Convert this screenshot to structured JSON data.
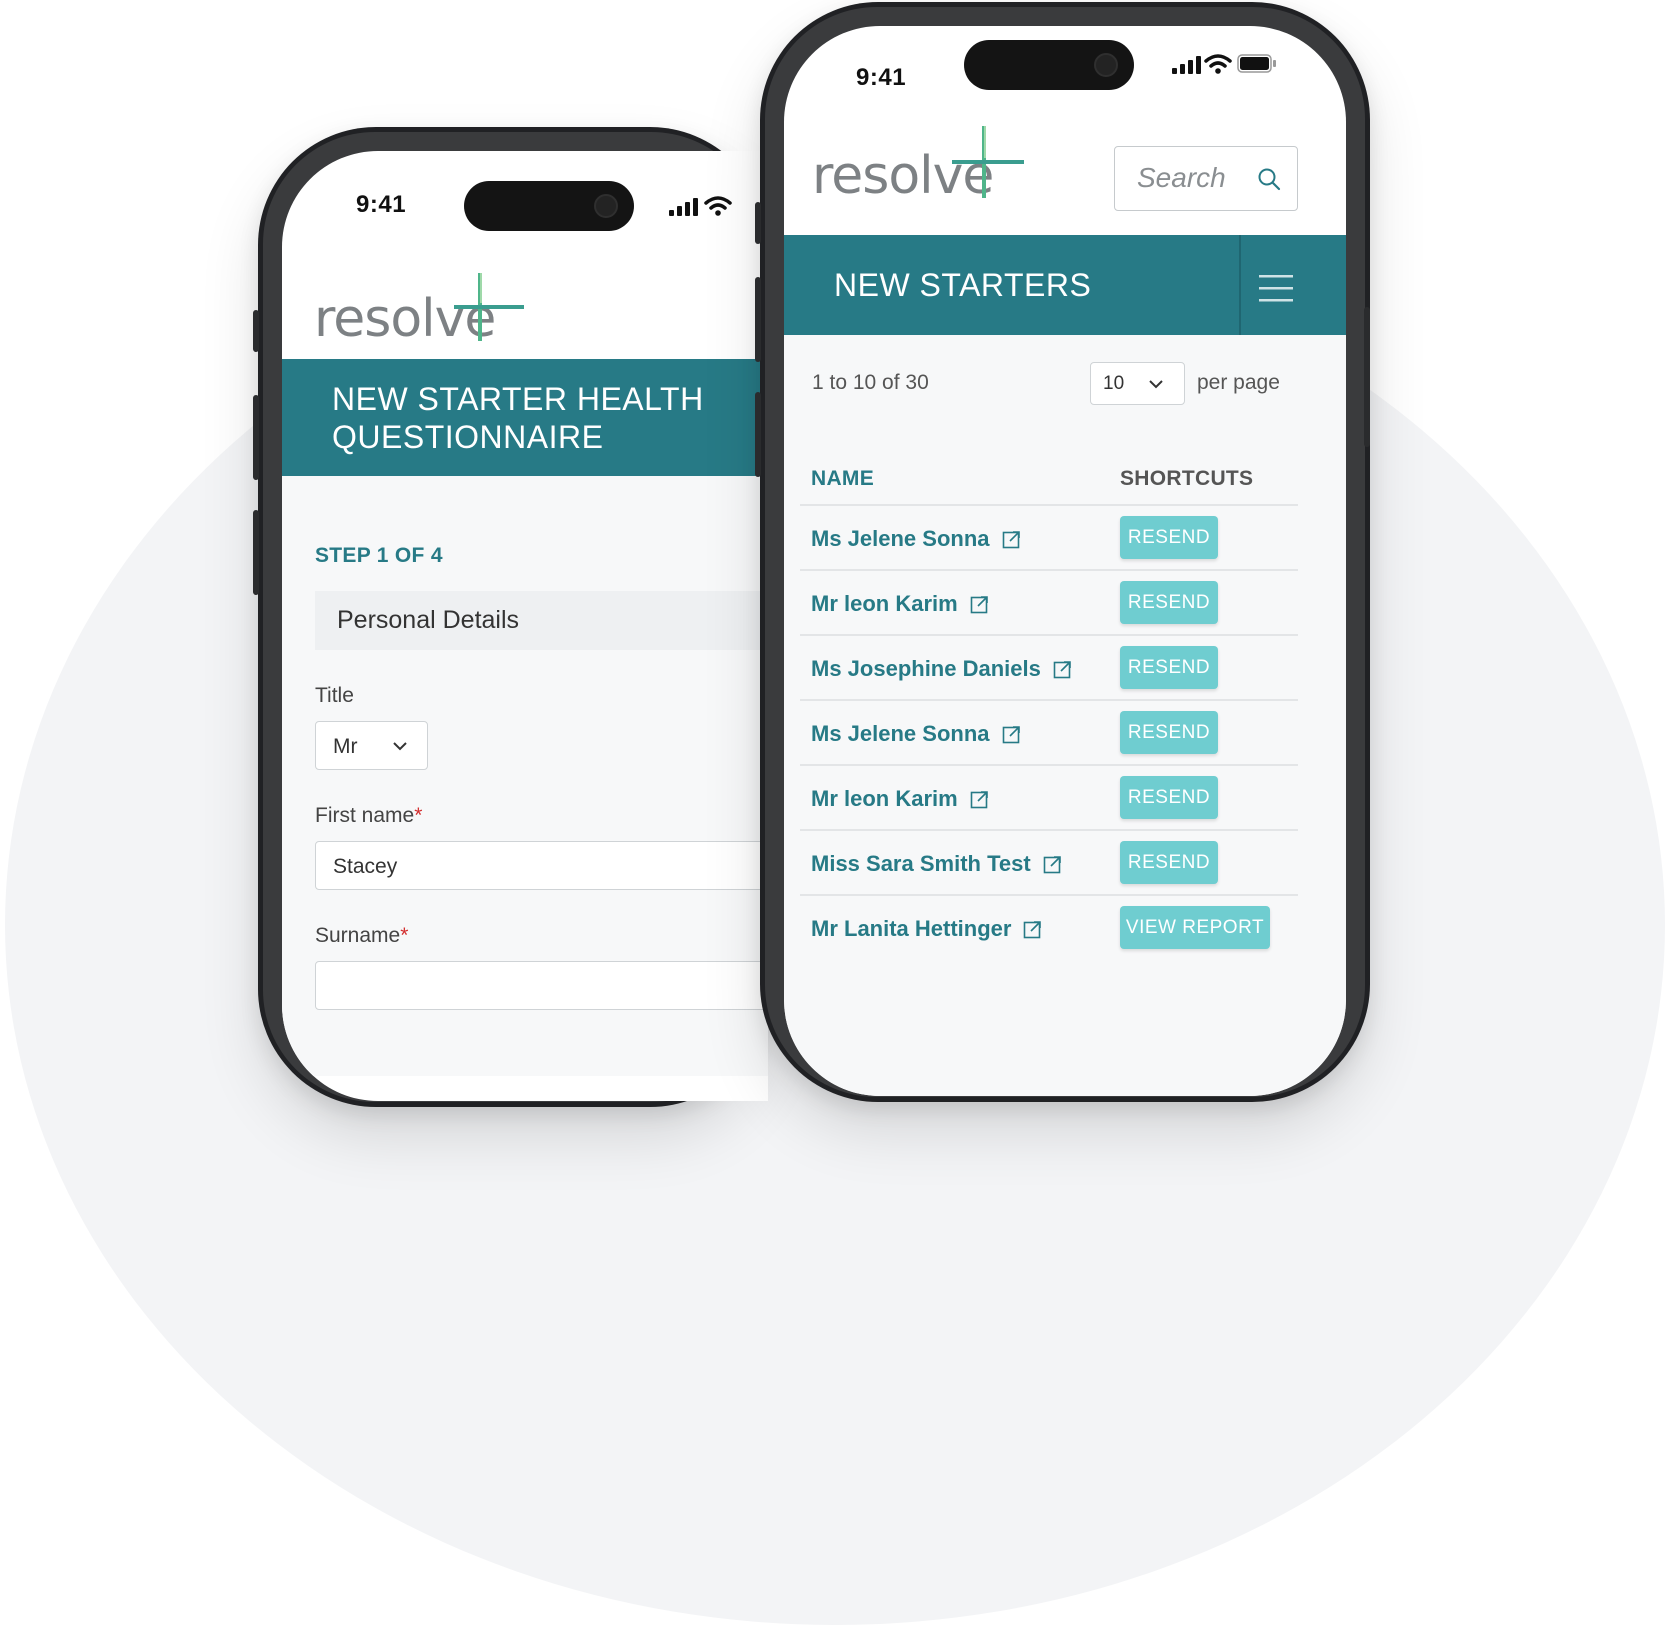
{
  "colors": {
    "brand_teal": "#277a86",
    "button_teal": "#6fcdd0",
    "required_red": "#d32f2f",
    "logo_gray": "#7d8184",
    "logo_green": "#4fb58a"
  },
  "icons": [
    "signal-icon",
    "wifi-icon",
    "battery-icon",
    "search-icon",
    "menu-icon",
    "chevron-down-icon",
    "external-link-icon",
    "logo-cross-icon"
  ],
  "questionnaire_phone": {
    "status_time": "9:41",
    "logo_text": "resolve",
    "banner_title_line1": "NEW STARTER HEALTH",
    "banner_title_line2": "QUESTIONNAIRE",
    "step_label": "STEP 1 OF 4",
    "section_title": "Personal Details",
    "title_label": "Title",
    "title_value": "Mr",
    "first_name_label": "First name",
    "first_name_value": "Stacey",
    "surname_label": "Surname",
    "required_mark": "*"
  },
  "starters_phone": {
    "status_time": "9:41",
    "logo_text": "resolve",
    "search_placeholder": "Search",
    "banner_title": "NEW STARTERS",
    "range_text": "1 to 10 of 30",
    "per_page_value": "10",
    "per_page_label": "per page",
    "col_name": "NAME",
    "col_shortcuts": "SHORTCUTS",
    "rows": [
      {
        "name": "Ms Jelene Sonna",
        "action": "RESEND"
      },
      {
        "name": "Mr leon Karim",
        "action": "RESEND"
      },
      {
        "name": "Ms Josephine Daniels",
        "action": "RESEND"
      },
      {
        "name": "Ms Jelene Sonna",
        "action": "RESEND"
      },
      {
        "name": "Mr leon Karim",
        "action": "RESEND"
      },
      {
        "name": "Miss Sara Smith Test",
        "action": "RESEND"
      },
      {
        "name": "Mr Lanita Hettinger",
        "action": "VIEW REPORT"
      }
    ]
  }
}
